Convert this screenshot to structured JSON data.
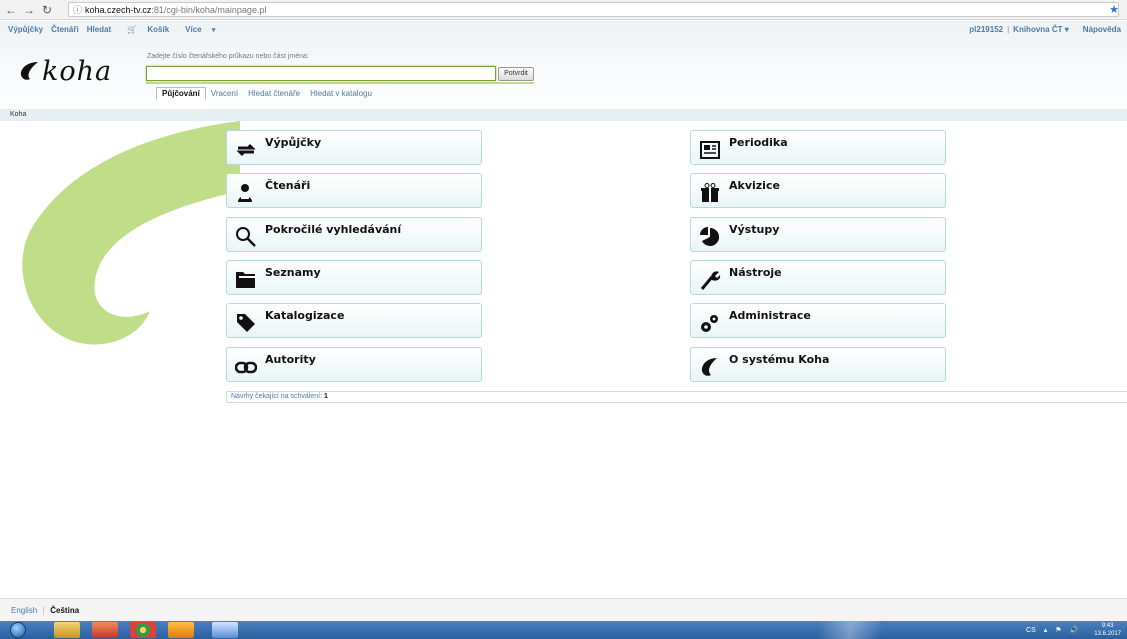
{
  "browser": {
    "url_host": "koha.czech-tv.cz",
    "url_path": ":81/cgi-bin/koha/mainpage.pl"
  },
  "topnav": {
    "items": [
      "Výpůjčky",
      "Čtenáři",
      "Hledat",
      "Košík",
      "Více"
    ],
    "user": "pl219152",
    "library": "Knihovna ČT",
    "help": "Nápověda"
  },
  "logo": {
    "text": "koha"
  },
  "search": {
    "label": "Zadejte číslo čtenářského průkazu nebo část jména:",
    "value": "",
    "submit": "Potvrdit",
    "tabs": [
      "Půjčování",
      "Vracení",
      "Hledat čtenáře",
      "Hledat v katalogu"
    ]
  },
  "breadcrumb": "Koha",
  "modules": {
    "left": [
      "Výpůjčky",
      "Čtenáři",
      "Pokročilé vyhledávání",
      "Seznamy",
      "Katalogizace",
      "Autority"
    ],
    "right": [
      "Periodika",
      "Akvizice",
      "Výstupy",
      "Nástroje",
      "Administrace",
      "O systému Koha"
    ]
  },
  "pending": {
    "label": "Návrhy čekající na schválení:",
    "count": "1"
  },
  "languages": {
    "english": "English",
    "czech": "Čeština"
  },
  "taskbar": {
    "lang": "CS",
    "time": "9:43",
    "date": "13.6.2017"
  },
  "colors": {
    "link": "#4f7aa3",
    "accent_green": "#b9d97a",
    "module_border": "#b9d8d9"
  }
}
